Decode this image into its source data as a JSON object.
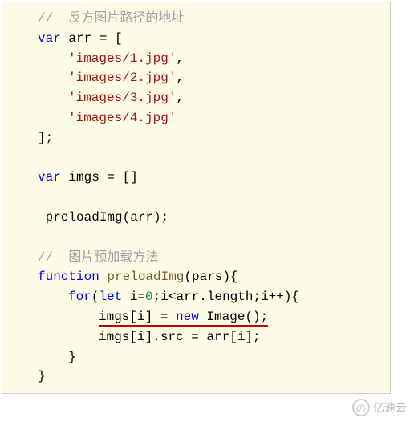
{
  "code": {
    "comment1": "//  反方图片路径的地址",
    "l1_kw": "var",
    "l1_rest": " arr = [",
    "s1": "'images/1.jpg'",
    "s2": "'images/2.jpg'",
    "s3": "'images/3.jpg'",
    "s4": "'images/4.jpg'",
    "close_bracket": "];",
    "l2_kw": "var",
    "l2_rest": " imgs = []",
    "preload_call": " preloadImg(arr);",
    "comment2": "//  图片预加载方法",
    "fn_kw": "function",
    "fn_name": " preloadImg",
    "fn_params": "(pars){",
    "for_kw": "for",
    "for_open": "(",
    "let_kw": "let",
    "for_body1": " i=",
    "zero": "0",
    "for_body2": ";i<arr.length;i++){",
    "assign_left": "imgs[i] = ",
    "new_kw": "new",
    "assign_right": " Image();",
    "src_line": "imgs[i].src = arr[i];",
    "brace1": "}",
    "brace2": "}",
    "brace3": "}",
    "comma": ","
  },
  "watermark": {
    "icon_glyph": "の",
    "text": "亿速云"
  }
}
